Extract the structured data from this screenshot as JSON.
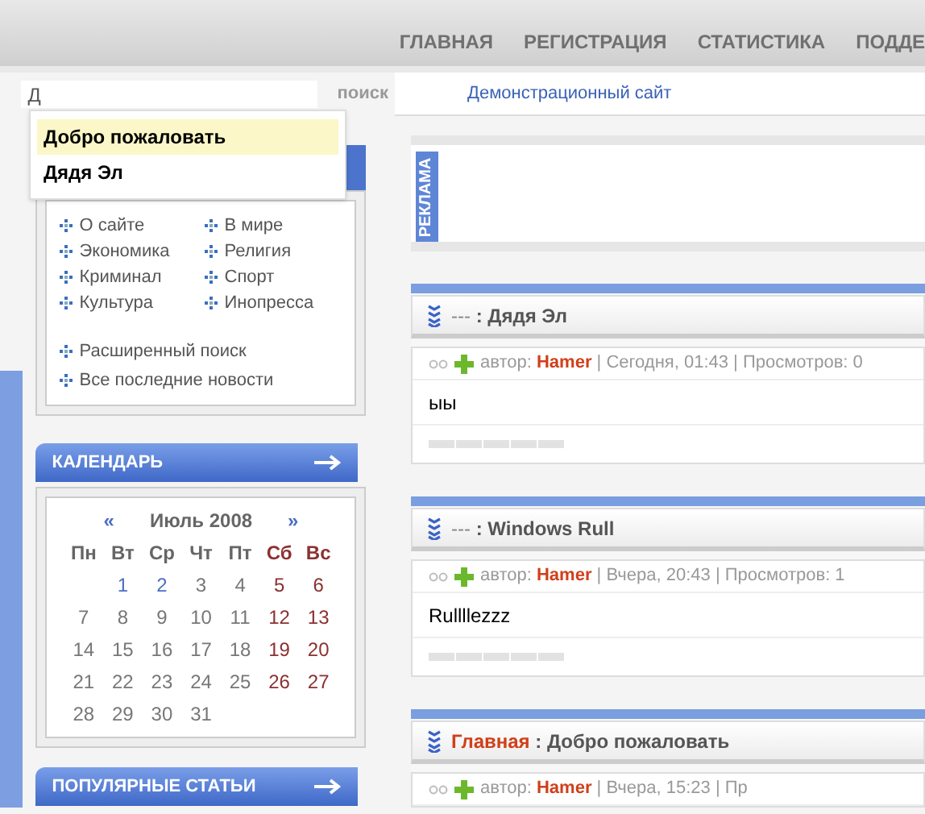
{
  "nav": [
    "ГЛАВНАЯ",
    "РЕГИСТРАЦИЯ",
    "СТАТИСТИКА",
    "ПОДДЕ"
  ],
  "search": {
    "value": "Д",
    "button": "поиск",
    "suggestions": [
      {
        "text": "Добро пожаловать",
        "selected": true
      },
      {
        "text": "Дядя Эл",
        "selected": false
      }
    ]
  },
  "menu": {
    "columns": [
      [
        "О сайте",
        "Экономика",
        "Криминал",
        "Культура"
      ],
      [
        "В мире",
        "Религия",
        "Спорт",
        "Инопресса"
      ]
    ],
    "extra": [
      "Расширенный поиск",
      "Все последние новости"
    ]
  },
  "calendar": {
    "title": "КАЛЕНДАРЬ",
    "prev": "«",
    "month": "Июль 2008",
    "next": "»",
    "weekdays": [
      "Пн",
      "Вт",
      "Ср",
      "Чт",
      "Пт",
      "Сб",
      "Вс"
    ],
    "weeks": [
      [
        {
          "kind": "blank"
        },
        {
          "kind": "day",
          "text": "1",
          "link": true
        },
        {
          "text": "2",
          "link": true
        },
        {
          "text": "3",
          "link": false
        },
        {
          "text": "4",
          "link": false
        },
        {
          "text": "5",
          "link": false
        },
        {
          "text": "6",
          "link": false
        }
      ],
      [
        {
          "text": "7",
          "link": false
        },
        {
          "text": "8",
          "link": false
        },
        {
          "text": "9",
          "link": false
        },
        {
          "text": "10",
          "link": false
        },
        {
          "text": "11",
          "link": false
        },
        {
          "text": "12",
          "link": false
        },
        {
          "text": "13",
          "link": false
        }
      ],
      [
        {
          "text": "14",
          "link": false
        },
        {
          "text": "15",
          "link": false
        },
        {
          "text": "16",
          "link": false
        },
        {
          "text": "17",
          "link": false
        },
        {
          "text": "18",
          "link": false
        },
        {
          "text": "19",
          "link": false
        },
        {
          "text": "20",
          "link": false
        }
      ],
      [
        {
          "text": "21",
          "link": false
        },
        {
          "text": "22",
          "link": false
        },
        {
          "text": "23",
          "link": false
        },
        {
          "text": "24",
          "link": false
        },
        {
          "text": "25",
          "link": false
        },
        {
          "text": "26",
          "link": false
        },
        {
          "text": "27",
          "link": false
        }
      ],
      [
        {
          "text": "28",
          "link": false
        },
        {
          "text": "29",
          "link": false
        },
        {
          "text": "30",
          "link": false
        },
        {
          "text": "31",
          "link": false
        }
      ]
    ]
  },
  "popular": {
    "title": "ПОПУЛЯРНЫЕ СТАТЬИ"
  },
  "site_link": "Демонстрационный сайт",
  "ad_label": "РЕКЛАМА",
  "posts": [
    {
      "category": "---",
      "category_link": false,
      "separator": ":",
      "title": "Дядя Эл",
      "author_label": "автор:",
      "author": "Hamer",
      "meta_separator": "|",
      "date": "Сегодня, 01:43",
      "views": "Просмотров: 0",
      "body": "ыы"
    },
    {
      "category": "---",
      "category_link": false,
      "separator": ":",
      "title": "Windows Rull",
      "author_label": "автор:",
      "author": "Hamer",
      "meta_separator": "|",
      "date": "Вчера, 20:43",
      "views": "Просмотров: 1",
      "body": "Rullllezzz"
    },
    {
      "category": "Главная",
      "category_link": true,
      "separator": ":",
      "title": "Добро пожаловать",
      "author_label": "автор:",
      "author": "Hamer",
      "meta_separator": "|",
      "date": "Вчера, 15:23",
      "views": "Пр"
    }
  ]
}
